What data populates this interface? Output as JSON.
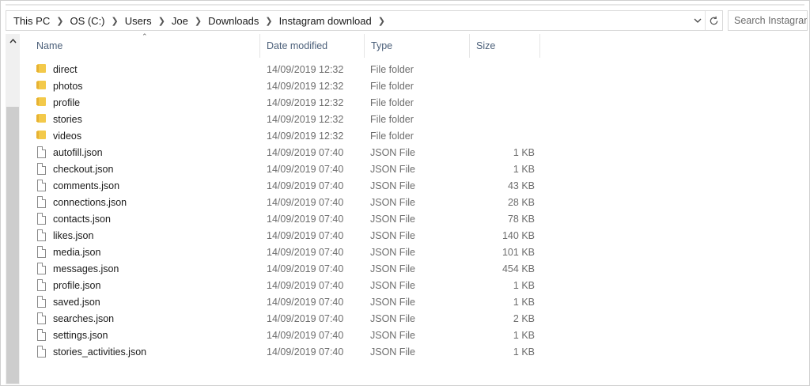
{
  "breadcrumb": [
    "This PC",
    "OS (C:)",
    "Users",
    "Joe",
    "Downloads",
    "Instagram download"
  ],
  "search": {
    "placeholder": "Search Instagram"
  },
  "columns": {
    "name": "Name",
    "date": "Date modified",
    "type": "Type",
    "size": "Size"
  },
  "files": [
    {
      "name": "direct",
      "date": "14/09/2019 12:32",
      "type": "File folder",
      "size": "",
      "icon": "folder-icon"
    },
    {
      "name": "photos",
      "date": "14/09/2019 12:32",
      "type": "File folder",
      "size": "",
      "icon": "folder-icon"
    },
    {
      "name": "profile",
      "date": "14/09/2019 12:32",
      "type": "File folder",
      "size": "",
      "icon": "folder-icon"
    },
    {
      "name": "stories",
      "date": "14/09/2019 12:32",
      "type": "File folder",
      "size": "",
      "icon": "folder-icon"
    },
    {
      "name": "videos",
      "date": "14/09/2019 12:32",
      "type": "File folder",
      "size": "",
      "icon": "folder-icon"
    },
    {
      "name": "autofill.json",
      "date": "14/09/2019 07:40",
      "type": "JSON File",
      "size": "1 KB",
      "icon": "file-icon"
    },
    {
      "name": "checkout.json",
      "date": "14/09/2019 07:40",
      "type": "JSON File",
      "size": "1 KB",
      "icon": "file-icon"
    },
    {
      "name": "comments.json",
      "date": "14/09/2019 07:40",
      "type": "JSON File",
      "size": "43 KB",
      "icon": "file-icon"
    },
    {
      "name": "connections.json",
      "date": "14/09/2019 07:40",
      "type": "JSON File",
      "size": "28 KB",
      "icon": "file-icon"
    },
    {
      "name": "contacts.json",
      "date": "14/09/2019 07:40",
      "type": "JSON File",
      "size": "78 KB",
      "icon": "file-icon"
    },
    {
      "name": "likes.json",
      "date": "14/09/2019 07:40",
      "type": "JSON File",
      "size": "140 KB",
      "icon": "file-icon"
    },
    {
      "name": "media.json",
      "date": "14/09/2019 07:40",
      "type": "JSON File",
      "size": "101 KB",
      "icon": "file-icon"
    },
    {
      "name": "messages.json",
      "date": "14/09/2019 07:40",
      "type": "JSON File",
      "size": "454 KB",
      "icon": "file-icon"
    },
    {
      "name": "profile.json",
      "date": "14/09/2019 07:40",
      "type": "JSON File",
      "size": "1 KB",
      "icon": "file-icon"
    },
    {
      "name": "saved.json",
      "date": "14/09/2019 07:40",
      "type": "JSON File",
      "size": "1 KB",
      "icon": "file-icon"
    },
    {
      "name": "searches.json",
      "date": "14/09/2019 07:40",
      "type": "JSON File",
      "size": "2 KB",
      "icon": "file-icon"
    },
    {
      "name": "settings.json",
      "date": "14/09/2019 07:40",
      "type": "JSON File",
      "size": "1 KB",
      "icon": "file-icon"
    },
    {
      "name": "stories_activities.json",
      "date": "14/09/2019 07:40",
      "type": "JSON File",
      "size": "1 KB",
      "icon": "file-icon"
    }
  ]
}
